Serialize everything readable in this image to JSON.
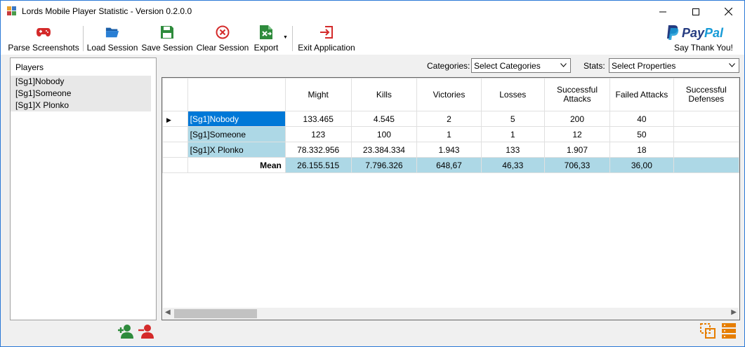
{
  "window": {
    "title": "Lords Mobile Player Statistic - Version 0.2.0.0"
  },
  "toolbar": {
    "buttons": [
      {
        "label": "Parse Screenshots",
        "icon": "gamepad-icon"
      },
      {
        "label": "Load Session",
        "icon": "folder-open-icon"
      },
      {
        "label": "Save Session",
        "icon": "save-icon"
      },
      {
        "label": "Clear Session",
        "icon": "clear-circle-icon"
      },
      {
        "label": "Export",
        "icon": "excel-export-icon"
      },
      {
        "label": "Exit Application",
        "icon": "exit-icon"
      }
    ],
    "paypal": {
      "brand_pay": "Pay",
      "brand_pal": "Pal",
      "thanks": "Say Thank You!"
    }
  },
  "players": {
    "header": "Players",
    "items": [
      "[Sg1]Nobody",
      "[Sg1]Someone",
      "[Sg1]X Plonko"
    ]
  },
  "filters": {
    "categories_label": "Categories:",
    "categories_value": "Select Categories",
    "stats_label": "Stats:",
    "stats_value": "Select Properties"
  },
  "grid": {
    "columns": [
      "Might",
      "Kills",
      "Victories",
      "Losses",
      "Successful Attacks",
      "Failed Attacks",
      "Successful Defenses"
    ],
    "rows": [
      {
        "name": "[Sg1]Nobody",
        "values": [
          "133.465",
          "4.545",
          "2",
          "5",
          "200",
          "40",
          ""
        ]
      },
      {
        "name": "[Sg1]Someone",
        "values": [
          "123",
          "100",
          "1",
          "1",
          "12",
          "50",
          ""
        ]
      },
      {
        "name": "[Sg1]X Plonko",
        "values": [
          "78.332.956",
          "23.384.334",
          "1.943",
          "133",
          "1.907",
          "18",
          ""
        ]
      }
    ],
    "mean": {
      "name": "Mean",
      "values": [
        "26.155.515",
        "7.796.326",
        "648,67",
        "46,33",
        "706,33",
        "36,00",
        ""
      ]
    }
  },
  "colors": {
    "selection": "#0078d7",
    "row_highlight": "#add8e6",
    "window_border": "#2b79d6"
  }
}
